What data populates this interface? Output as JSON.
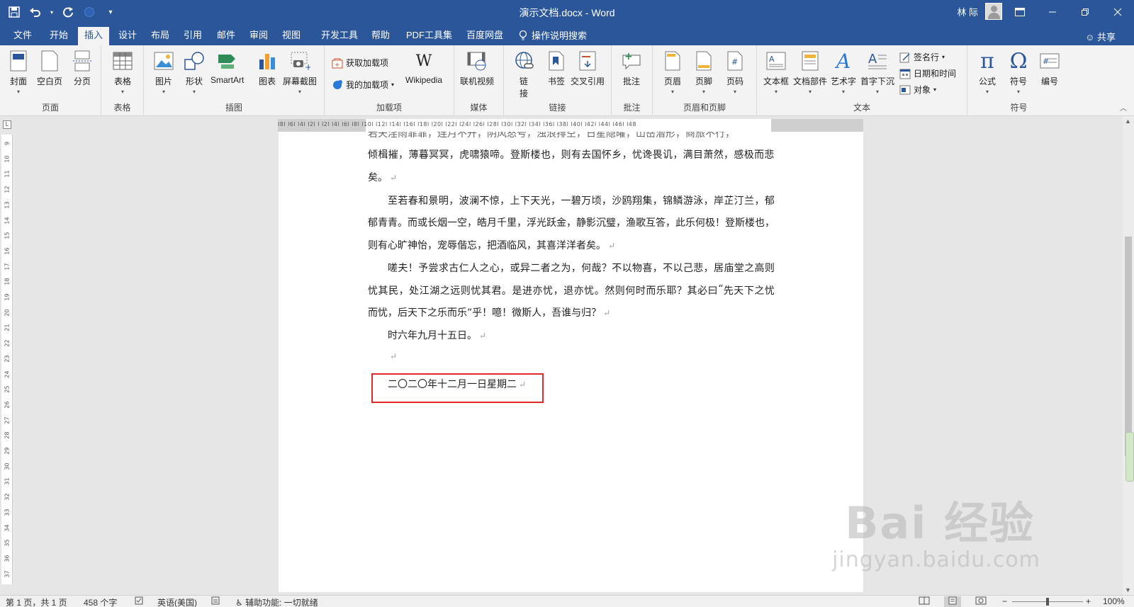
{
  "app": {
    "title": "演示文档.docx  -  Word",
    "user_name": "林 际",
    "share_label": "共享",
    "tell_me": "操作说明搜索",
    "accent_color": "#2b579a"
  },
  "qat": {
    "save_icon": "save-icon",
    "undo_icon": "undo-icon",
    "redo_icon": "redo-icon",
    "customize_icon": "chevron-down-icon"
  },
  "tabs": [
    {
      "label": "文件"
    },
    {
      "label": "开始"
    },
    {
      "label": "插入",
      "active": true
    },
    {
      "label": "设计"
    },
    {
      "label": "布局"
    },
    {
      "label": "引用"
    },
    {
      "label": "邮件"
    },
    {
      "label": "审阅"
    },
    {
      "label": "视图"
    },
    {
      "label": "开发工具"
    },
    {
      "label": "帮助"
    },
    {
      "label": "PDF工具集"
    },
    {
      "label": "百度网盘"
    }
  ],
  "ribbon": {
    "pages": {
      "label": "页面",
      "cover": "封面",
      "blank": "空白页",
      "break": "分页"
    },
    "tables": {
      "label": "表格",
      "table": "表格"
    },
    "illustrations": {
      "label": "插图",
      "picture": "图片",
      "shapes": "形状",
      "smartart": "SmartArt",
      "chart": "图表",
      "screenshot": "屏幕截图"
    },
    "addins": {
      "label": "加载项",
      "get": "获取加载项",
      "mine": "我的加载项",
      "wikipedia": "Wikipedia"
    },
    "media": {
      "label": "媒体",
      "video": "联机视频"
    },
    "links": {
      "label": "链接",
      "link_line1": "链",
      "link_line2": "接",
      "bookmark": "书签",
      "crossref": "交叉引用"
    },
    "comments": {
      "label": "批注",
      "comment": "批注"
    },
    "headerfooter": {
      "label": "页眉和页脚",
      "header": "页眉",
      "footer": "页脚",
      "pagenum": "页码"
    },
    "text": {
      "label": "文本",
      "textbox": "文本框",
      "quickparts": "文档部件",
      "wordart": "艺术字",
      "dropcap": "首字下沉",
      "signature": "签名行",
      "datetime": "日期和时间",
      "object": "对象"
    },
    "symbols": {
      "label": "符号",
      "equation": "公式",
      "symbol": "符号",
      "number": "编号"
    }
  },
  "ruler": {
    "marks": "l8l  l6l  l4l  l2l     l   l2l   l4l   l6l   l8l  l10l  l12l  l14l  l16l  l18l  l20l  l22l  l24l  l26l  l28l  l30l  l32l  l34l  l36l  l38l  l40l  l42l  l44l  l46l  l48",
    "vertical": [
      "9",
      "10",
      "11",
      "12",
      "13",
      "14",
      "15",
      "16",
      "17",
      "18",
      "19",
      "20",
      "21",
      "22",
      "23",
      "24",
      "25",
      "26",
      "27",
      "28",
      "29",
      "30",
      "31",
      "32",
      "33",
      "34",
      "35",
      "36",
      "37"
    ],
    "corner": "L"
  },
  "document": {
    "lines": [
      {
        "text": "倾楫摧，薄暮冥冥，虎啸猿啼。登斯楼也，则有去国怀乡，忧谗畏讥，满目萧然，感极而悲",
        "indent": false,
        "justify": true
      },
      {
        "text": "矣。",
        "indent": false,
        "justify": false,
        "mark": true
      },
      {
        "text": "至若春和景明，波澜不惊，上下天光，一碧万顷，沙鸥翔集，锦鳞游泳，岸芷汀兰，郁",
        "indent": true,
        "justify": true
      },
      {
        "text": "郁青青。而或长烟一空，皓月千里，浮光跃金，静影沉璧，渔歌互答，此乐何极！登斯楼也，",
        "indent": false,
        "justify": true
      },
      {
        "text": "则有心旷神怡，宠辱偕忘，把酒临风，其喜洋洋者矣。",
        "indent": false,
        "justify": false,
        "mark": true
      },
      {
        "text": "嗟夫！予尝求古仁人之心，或异二者之为，何哉？不以物喜，不以己悲，居庙堂之高则",
        "indent": true,
        "justify": true
      },
      {
        "text": "忧其民，处江湖之远则忧其君。是进亦忧，退亦忧。然则何时而乐耶？其必曰“先天下之忧",
        "indent": false,
        "justify": true
      },
      {
        "text": "而忧，后天下之乐而乐”乎！噫！微斯人，吾谁与归？",
        "indent": false,
        "justify": false,
        "mark": true
      },
      {
        "text": "时六年九月十五日。",
        "indent": true,
        "justify": false,
        "mark": true
      },
      {
        "text": "",
        "indent": true,
        "justify": false,
        "mark": true
      },
      {
        "text": "二〇二〇年十二月一日星期二",
        "indent": true,
        "justify": false,
        "mark": true
      }
    ],
    "top_cut_text": "若夫淫雨霏霏，连月不开，阴风怒号，浊浪排空，日星隐曜，山岳潜形，商旅不行，",
    "para_mark": "↵"
  },
  "statusbar": {
    "page": "第 1 页，共 1 页",
    "words": "458 个字",
    "lang": "英语(美国)",
    "accessibility": "辅助功能: 一切就绪",
    "zoom": "100%",
    "zoom_minus": "−",
    "zoom_plus": "+"
  },
  "watermark": {
    "main": "Bai 经验",
    "url": "jingyan.baidu.com"
  }
}
